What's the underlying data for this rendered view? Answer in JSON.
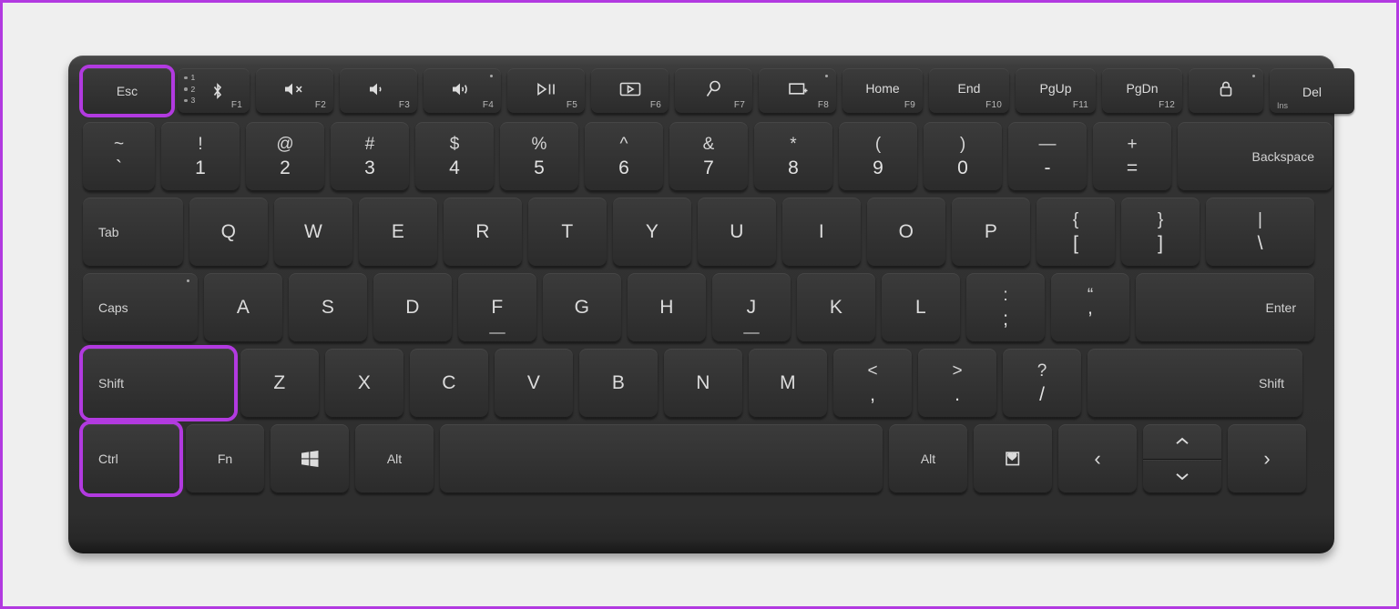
{
  "meta": {
    "title": "Compact wireless keyboard layout",
    "background_color": "#efefef",
    "border_color": "#b23ae0",
    "key_color": "#343434",
    "chassis_color": "#2e2e2e",
    "highlight_color": "#b23ae0",
    "highlighted_keys": [
      "Esc",
      "Shift",
      "Ctrl"
    ]
  },
  "rows": {
    "function_row": [
      {
        "id": "esc",
        "label": "Esc",
        "type": "mod",
        "align": "center",
        "highlight": true
      },
      {
        "id": "f1",
        "label": "",
        "type": "bluetooth",
        "fnum": "F1",
        "dots": [
          "1",
          "2",
          "3"
        ],
        "icon": "bluetooth-icon"
      },
      {
        "id": "f2",
        "label": "",
        "type": "fkey",
        "fnum": "F2",
        "icon": "volume-mute-icon"
      },
      {
        "id": "f3",
        "label": "",
        "type": "fkey",
        "fnum": "F3",
        "icon": "volume-down-icon"
      },
      {
        "id": "f4",
        "label": "",
        "type": "fkey",
        "fnum": "F4",
        "icon": "volume-up-icon",
        "led": true
      },
      {
        "id": "f5",
        "label": "",
        "type": "fkey",
        "fnum": "F5",
        "icon": "play-pause-icon"
      },
      {
        "id": "f6",
        "label": "",
        "type": "fkey",
        "fnum": "F6",
        "icon": "screen-snip-icon"
      },
      {
        "id": "f7",
        "label": "",
        "type": "fkey",
        "fnum": "F7",
        "icon": "search-icon"
      },
      {
        "id": "f8",
        "label": "",
        "type": "fkey",
        "fnum": "F8",
        "icon": "project-display-icon",
        "led": true
      },
      {
        "id": "f9",
        "label": "Home",
        "type": "fname",
        "fnum": "F9"
      },
      {
        "id": "f10",
        "label": "End",
        "type": "fname",
        "fnum": "F10"
      },
      {
        "id": "f11",
        "label": "PgUp",
        "type": "fname",
        "fnum": "F11"
      },
      {
        "id": "f12",
        "label": "PgDn",
        "type": "fname",
        "fnum": "F12"
      },
      {
        "id": "lock",
        "label": "",
        "type": "fkey",
        "fnum": "",
        "icon": "lock-icon",
        "led": true
      },
      {
        "id": "del",
        "label": "Del",
        "type": "fname",
        "fnum": "",
        "sub": "Ins"
      }
    ],
    "number_row": [
      {
        "id": "grave",
        "top": "~",
        "bot": "`"
      },
      {
        "id": "one",
        "top": "!",
        "bot": "1"
      },
      {
        "id": "two",
        "top": "@",
        "bot": "2"
      },
      {
        "id": "three",
        "top": "#",
        "bot": "3"
      },
      {
        "id": "four",
        "top": "$",
        "bot": "4"
      },
      {
        "id": "five",
        "top": "%",
        "bot": "5"
      },
      {
        "id": "six",
        "top": "^",
        "bot": "6"
      },
      {
        "id": "seven",
        "top": "&",
        "bot": "7"
      },
      {
        "id": "eight",
        "top": "*",
        "bot": "8"
      },
      {
        "id": "nine",
        "top": "(",
        "bot": "9"
      },
      {
        "id": "zero",
        "top": ")",
        "bot": "0"
      },
      {
        "id": "minus",
        "top": "—",
        "bot": "-"
      },
      {
        "id": "equal",
        "top": "+",
        "bot": "="
      },
      {
        "id": "backspace",
        "label": "Backspace",
        "type": "mod",
        "align": "right"
      }
    ],
    "qwerty_row": [
      {
        "id": "tab",
        "label": "Tab",
        "type": "mod",
        "align": "left"
      },
      {
        "id": "q",
        "label": "Q"
      },
      {
        "id": "w",
        "label": "W"
      },
      {
        "id": "e",
        "label": "E"
      },
      {
        "id": "r",
        "label": "R"
      },
      {
        "id": "t",
        "label": "T"
      },
      {
        "id": "y",
        "label": "Y"
      },
      {
        "id": "u",
        "label": "U"
      },
      {
        "id": "i",
        "label": "I"
      },
      {
        "id": "o",
        "label": "O"
      },
      {
        "id": "p",
        "label": "P"
      },
      {
        "id": "lbracket",
        "top": "{",
        "bot": "["
      },
      {
        "id": "rbracket",
        "top": "}",
        "bot": "]"
      },
      {
        "id": "backslash",
        "top": "|",
        "bot": "\\"
      }
    ],
    "home_row": [
      {
        "id": "caps",
        "label": "Caps",
        "type": "mod",
        "align": "left",
        "led": true
      },
      {
        "id": "a",
        "label": "A"
      },
      {
        "id": "s",
        "label": "S"
      },
      {
        "id": "d",
        "label": "D"
      },
      {
        "id": "f",
        "label": "F",
        "home": true
      },
      {
        "id": "g",
        "label": "G"
      },
      {
        "id": "h",
        "label": "H"
      },
      {
        "id": "j",
        "label": "J",
        "home": true
      },
      {
        "id": "k",
        "label": "K"
      },
      {
        "id": "l",
        "label": "L"
      },
      {
        "id": "semicolon",
        "top": ":",
        "bot": ";"
      },
      {
        "id": "quote",
        "top": "“",
        "bot": "’"
      },
      {
        "id": "enter",
        "label": "Enter",
        "type": "mod",
        "align": "right"
      }
    ],
    "shift_row": [
      {
        "id": "lshift",
        "label": "Shift",
        "type": "mod",
        "align": "left",
        "highlight": true
      },
      {
        "id": "z",
        "label": "Z"
      },
      {
        "id": "x",
        "label": "X"
      },
      {
        "id": "c",
        "label": "C"
      },
      {
        "id": "v",
        "label": "V"
      },
      {
        "id": "b",
        "label": "B"
      },
      {
        "id": "n",
        "label": "N"
      },
      {
        "id": "m",
        "label": "M"
      },
      {
        "id": "comma",
        "top": "<",
        "bot": ","
      },
      {
        "id": "period",
        "top": ">",
        "bot": "."
      },
      {
        "id": "slash",
        "top": "?",
        "bot": "/"
      },
      {
        "id": "rshift",
        "label": "Shift",
        "type": "mod",
        "align": "right"
      }
    ],
    "space_row": [
      {
        "id": "ctrl",
        "label": "Ctrl",
        "type": "mod",
        "align": "left",
        "highlight": true
      },
      {
        "id": "fn",
        "label": "Fn",
        "type": "mod",
        "align": "center"
      },
      {
        "id": "win",
        "label": "",
        "type": "icon",
        "icon": "windows-logo-icon"
      },
      {
        "id": "lalt",
        "label": "Alt",
        "type": "mod",
        "align": "center"
      },
      {
        "id": "space",
        "label": "",
        "type": "blank"
      },
      {
        "id": "ralt",
        "label": "Alt",
        "type": "mod",
        "align": "center"
      },
      {
        "id": "emoji",
        "label": "",
        "type": "icon",
        "icon": "emoji-heart-icon"
      },
      {
        "id": "left",
        "label": "‹",
        "type": "arrow",
        "icon": "arrow-left-icon"
      },
      {
        "id": "updown",
        "label": "",
        "type": "updown",
        "up": "⌃",
        "down": "⌄",
        "icon": "arrow-up-down-icon"
      },
      {
        "id": "right",
        "label": "›",
        "type": "arrow",
        "icon": "arrow-right-icon"
      }
    ]
  }
}
